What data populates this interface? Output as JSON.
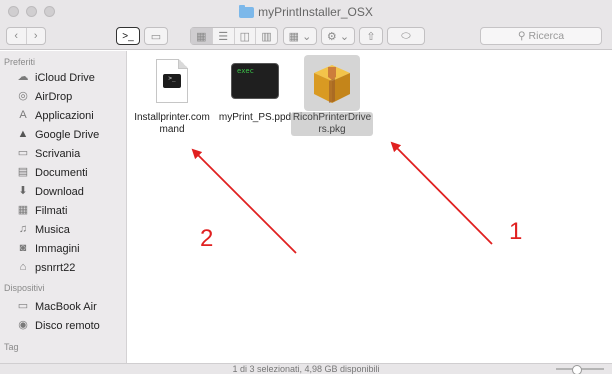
{
  "window": {
    "title": "myPrintInstaller_OSX"
  },
  "toolbar": {
    "search_placeholder": "Ricerca"
  },
  "sidebar": {
    "favorites_header": "Preferiti",
    "favorites": [
      {
        "label": "iCloud Drive",
        "icon": "cloud-icon"
      },
      {
        "label": "AirDrop",
        "icon": "airdrop-icon"
      },
      {
        "label": "Applicazioni",
        "icon": "applications-icon"
      },
      {
        "label": "Google Drive",
        "icon": "google-drive-icon"
      },
      {
        "label": "Scrivania",
        "icon": "desktop-icon"
      },
      {
        "label": "Documenti",
        "icon": "documents-icon"
      },
      {
        "label": "Download",
        "icon": "download-icon"
      },
      {
        "label": "Filmati",
        "icon": "movies-icon"
      },
      {
        "label": "Musica",
        "icon": "music-icon"
      },
      {
        "label": "Immagini",
        "icon": "pictures-icon"
      },
      {
        "label": "psnrrt22",
        "icon": "home-icon"
      }
    ],
    "devices_header": "Dispositivi",
    "devices": [
      {
        "label": "MacBook Air",
        "icon": "laptop-icon"
      },
      {
        "label": "Disco remoto",
        "icon": "disc-icon"
      }
    ],
    "tags_header": "Tag"
  },
  "files": [
    {
      "name": "Installprinter.command",
      "line1": "Installprinter.com",
      "line2": "mand",
      "icon": "terminal-script-icon",
      "selected": false
    },
    {
      "name": "myPrint_PS.ppd",
      "line1": "myPrint_PS.ppd",
      "line2": "",
      "icon": "exec-icon",
      "icon_text": "exec",
      "selected": false
    },
    {
      "name": "RicohPrinterDrivers.pkg",
      "line1": "RicohPrinterDrive",
      "line2": "rs.pkg",
      "icon": "package-icon",
      "selected": true
    }
  ],
  "annotations": [
    {
      "label": "1",
      "color": "#e02020"
    },
    {
      "label": "2",
      "color": "#e02020"
    }
  ],
  "status": {
    "text": "1 di 3 selezionati, 4,98 GB disponibili"
  }
}
